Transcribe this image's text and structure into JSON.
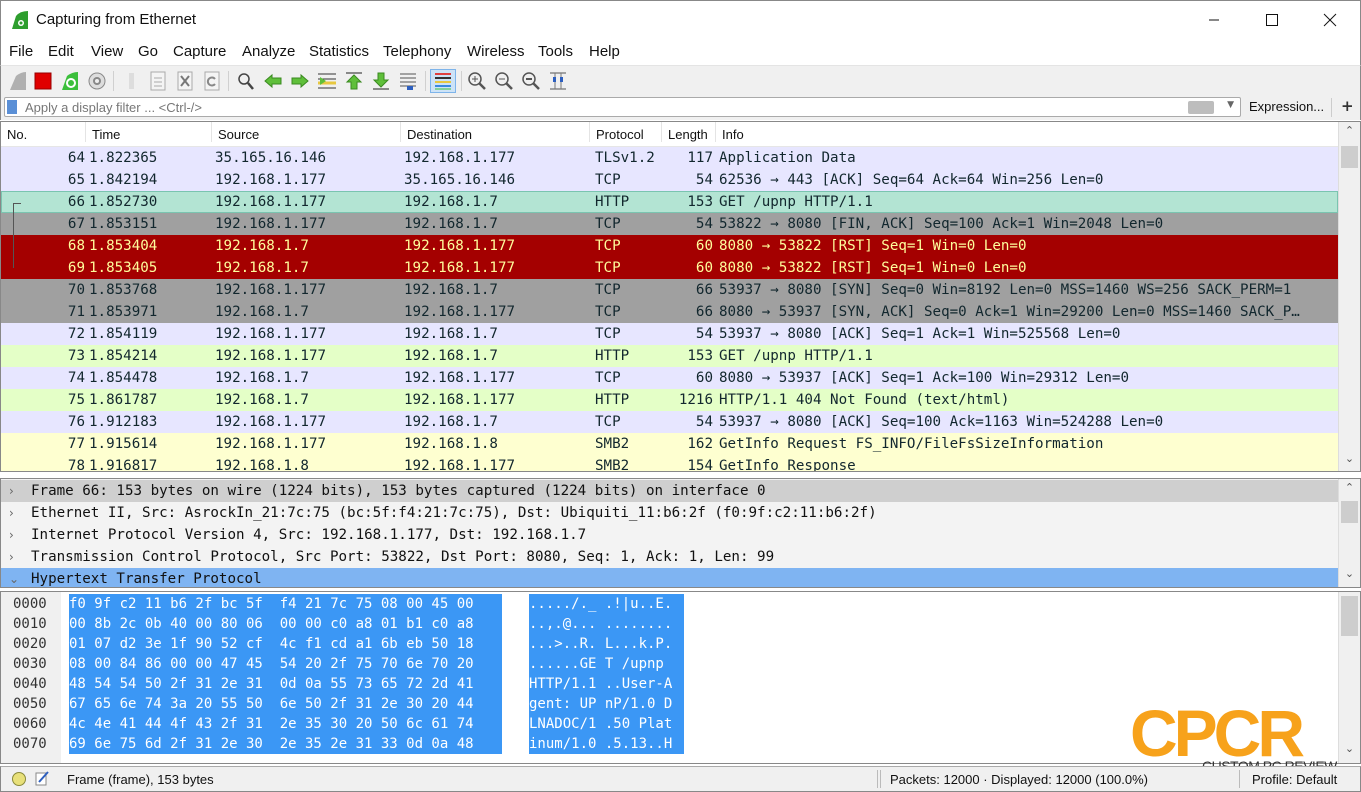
{
  "window": {
    "title": "Capturing from Ethernet",
    "minimize_glyph": "—",
    "maximize_glyph": "☐",
    "close_glyph": "✕"
  },
  "menu": [
    "File",
    "Edit",
    "View",
    "Go",
    "Capture",
    "Analyze",
    "Statistics",
    "Telephony",
    "Wireless",
    "Tools",
    "Help"
  ],
  "toolbar": {
    "buttons": [
      {
        "name": "start-capture",
        "icon": "shark-fin-icon"
      },
      {
        "name": "stop-capture",
        "icon": "stop-square-icon"
      },
      {
        "name": "restart-capture",
        "icon": "restart-fin-icon"
      },
      {
        "name": "capture-options",
        "icon": "gear-icon"
      },
      {
        "name": "open-file",
        "icon": "open-file-icon"
      },
      {
        "name": "save-file",
        "icon": "document-icon"
      },
      {
        "name": "close-file",
        "icon": "close-file-icon"
      },
      {
        "name": "reload-file",
        "icon": "reload-icon"
      },
      {
        "name": "find-packet",
        "icon": "search-icon"
      },
      {
        "name": "go-back",
        "icon": "arrow-left-icon"
      },
      {
        "name": "go-forward",
        "icon": "arrow-right-icon"
      },
      {
        "name": "go-to-packet",
        "icon": "go-to-packet-icon"
      },
      {
        "name": "go-first",
        "icon": "arrow-up-icon"
      },
      {
        "name": "go-last",
        "icon": "arrow-down-icon"
      },
      {
        "name": "autoscroll",
        "icon": "autoscroll-icon"
      },
      {
        "name": "colorize",
        "icon": "colorize-icon"
      },
      {
        "name": "zoom-in",
        "icon": "zoom-in-icon"
      },
      {
        "name": "zoom-out",
        "icon": "zoom-out-icon"
      },
      {
        "name": "normal-size",
        "icon": "zoom-reset-icon"
      },
      {
        "name": "resize-columns",
        "icon": "resize-columns-icon"
      }
    ]
  },
  "filter": {
    "placeholder": "Apply a display filter ... <Ctrl-/>",
    "value": "",
    "expression_label": "Expression...",
    "add_label": "+"
  },
  "packet_list": {
    "columns": [
      "No.",
      "Time",
      "Source",
      "Destination",
      "Protocol",
      "Length",
      "Info"
    ],
    "rows": [
      {
        "no": "64",
        "time": "1.822365",
        "src": "35.165.16.146",
        "dst": "192.168.1.177",
        "proto": "TLSv1.2",
        "len": "117",
        "info": "Application Data",
        "bg": "#e7e6ff",
        "fg": "#12272e"
      },
      {
        "no": "65",
        "time": "1.842194",
        "src": "192.168.1.177",
        "dst": "35.165.16.146",
        "proto": "TCP",
        "len": "54",
        "info": "62536 → 443 [ACK] Seq=64 Ack=64 Win=256 Len=0",
        "bg": "#e7e6ff",
        "fg": "#12272e"
      },
      {
        "no": "66",
        "time": "1.852730",
        "src": "192.168.1.177",
        "dst": "192.168.1.7",
        "proto": "HTTP",
        "len": "153",
        "info": "GET /upnp HTTP/1.1",
        "bg": "#b3e4d3",
        "fg": "#12272e",
        "selected": true
      },
      {
        "no": "67",
        "time": "1.853151",
        "src": "192.168.1.177",
        "dst": "192.168.1.7",
        "proto": "TCP",
        "len": "54",
        "info": "53822 → 8080 [FIN, ACK] Seq=100 Ack=1 Win=2048 Len=0",
        "bg": "#a0a0a0",
        "fg": "#12272e"
      },
      {
        "no": "68",
        "time": "1.853404",
        "src": "192.168.1.7",
        "dst": "192.168.1.177",
        "proto": "TCP",
        "len": "60",
        "info": "8080 → 53822 [RST] Seq=1 Win=0 Len=0",
        "bg": "#a40000",
        "fg": "#fffc9c"
      },
      {
        "no": "69",
        "time": "1.853405",
        "src": "192.168.1.7",
        "dst": "192.168.1.177",
        "proto": "TCP",
        "len": "60",
        "info": "8080 → 53822 [RST] Seq=1 Win=0 Len=0",
        "bg": "#a40000",
        "fg": "#fffc9c"
      },
      {
        "no": "70",
        "time": "1.853768",
        "src": "192.168.1.177",
        "dst": "192.168.1.7",
        "proto": "TCP",
        "len": "66",
        "info": "53937 → 8080 [SYN] Seq=0 Win=8192 Len=0 MSS=1460 WS=256 SACK_PERM=1",
        "bg": "#a0a0a0",
        "fg": "#12272e"
      },
      {
        "no": "71",
        "time": "1.853971",
        "src": "192.168.1.7",
        "dst": "192.168.1.177",
        "proto": "TCP",
        "len": "66",
        "info": "8080 → 53937 [SYN, ACK] Seq=0 Ack=1 Win=29200 Len=0 MSS=1460 SACK_P…",
        "bg": "#a0a0a0",
        "fg": "#12272e"
      },
      {
        "no": "72",
        "time": "1.854119",
        "src": "192.168.1.177",
        "dst": "192.168.1.7",
        "proto": "TCP",
        "len": "54",
        "info": "53937 → 8080 [ACK] Seq=1 Ack=1 Win=525568 Len=0",
        "bg": "#e7e6ff",
        "fg": "#12272e"
      },
      {
        "no": "73",
        "time": "1.854214",
        "src": "192.168.1.177",
        "dst": "192.168.1.7",
        "proto": "HTTP",
        "len": "153",
        "info": "GET /upnp HTTP/1.1",
        "bg": "#e4ffc7",
        "fg": "#12272e"
      },
      {
        "no": "74",
        "time": "1.854478",
        "src": "192.168.1.7",
        "dst": "192.168.1.177",
        "proto": "TCP",
        "len": "60",
        "info": "8080 → 53937 [ACK] Seq=1 Ack=100 Win=29312 Len=0",
        "bg": "#e7e6ff",
        "fg": "#12272e"
      },
      {
        "no": "75",
        "time": "1.861787",
        "src": "192.168.1.7",
        "dst": "192.168.1.177",
        "proto": "HTTP",
        "len": "1216",
        "info": "HTTP/1.1 404 Not Found  (text/html)",
        "bg": "#e4ffc7",
        "fg": "#12272e"
      },
      {
        "no": "76",
        "time": "1.912183",
        "src": "192.168.1.177",
        "dst": "192.168.1.7",
        "proto": "TCP",
        "len": "54",
        "info": "53937 → 8080 [ACK] Seq=100 Ack=1163 Win=524288 Len=0",
        "bg": "#e7e6ff",
        "fg": "#12272e"
      },
      {
        "no": "77",
        "time": "1.915614",
        "src": "192.168.1.177",
        "dst": "192.168.1.8",
        "proto": "SMB2",
        "len": "162",
        "info": "GetInfo Request FS_INFO/FileFsSizeInformation",
        "bg": "#feffd0",
        "fg": "#12272e"
      },
      {
        "no": "78",
        "time": "1.916817",
        "src": "192.168.1.8",
        "dst": "192.168.1.177",
        "proto": "SMB2",
        "len": "154",
        "info": "GetInfo Response",
        "bg": "#feffd0",
        "fg": "#12272e"
      }
    ]
  },
  "details": {
    "rows": [
      {
        "arrow": "›",
        "text": "Frame 66: 153 bytes on wire (1224 bits), 153 bytes captured (1224 bits) on interface 0",
        "state": "collapsed",
        "bg": "#cfcfcf"
      },
      {
        "arrow": "›",
        "text": "Ethernet II, Src: AsrockIn_21:7c:75 (bc:5f:f4:21:7c:75), Dst: Ubiquiti_11:b6:2f (f0:9f:c2:11:b6:2f)",
        "state": "collapsed",
        "bg": ""
      },
      {
        "arrow": "›",
        "text": "Internet Protocol Version 4, Src: 192.168.1.177, Dst: 192.168.1.7",
        "state": "collapsed",
        "bg": ""
      },
      {
        "arrow": "›",
        "text": "Transmission Control Protocol, Src Port: 53822, Dst Port: 8080, Seq: 1, Ack: 1, Len: 99",
        "state": "collapsed",
        "bg": ""
      },
      {
        "arrow": "⌄",
        "text": "Hypertext Transfer Protocol",
        "state": "expanded",
        "bg": "#7fb4f2"
      }
    ]
  },
  "bytes": {
    "rows": [
      {
        "offset": "0000",
        "hex": "f0 9f c2 11 b6 2f bc 5f  f4 21 7c 75 08 00 45 00",
        "ascii": "...../._ .!|u..E."
      },
      {
        "offset": "0010",
        "hex": "00 8b 2c 0b 40 00 80 06  00 00 c0 a8 01 b1 c0 a8",
        "ascii": "..,.@... ........"
      },
      {
        "offset": "0020",
        "hex": "01 07 d2 3e 1f 90 52 cf  4c f1 cd a1 6b eb 50 18",
        "ascii": "...>..R. L...k.P."
      },
      {
        "offset": "0030",
        "hex": "08 00 84 86 00 00 47 45  54 20 2f 75 70 6e 70 20",
        "ascii": "......GE T /upnp "
      },
      {
        "offset": "0040",
        "hex": "48 54 54 50 2f 31 2e 31  0d 0a 55 73 65 72 2d 41",
        "ascii": "HTTP/1.1 ..User-A"
      },
      {
        "offset": "0050",
        "hex": "67 65 6e 74 3a 20 55 50  6e 50 2f 31 2e 30 20 44",
        "ascii": "gent: UP nP/1.0 D"
      },
      {
        "offset": "0060",
        "hex": "4c 4e 41 44 4f 43 2f 31  2e 35 30 20 50 6c 61 74",
        "ascii": "LNADOC/1 .50 Plat"
      },
      {
        "offset": "0070",
        "hex": "69 6e 75 6d 2f 31 2e 30  2e 35 2e 31 33 0d 0a 48",
        "ascii": "inum/1.0 .5.13..H"
      }
    ]
  },
  "status": {
    "field_info": "Frame (frame), 153 bytes",
    "packets": "Packets: 12000 · Displayed: 12000 (100.0%)",
    "profile": "Profile: Default"
  },
  "watermark": {
    "logo": "CPCR",
    "subtitle": "CUSTOM PC REVIEW",
    "color": "#f7a21b"
  }
}
